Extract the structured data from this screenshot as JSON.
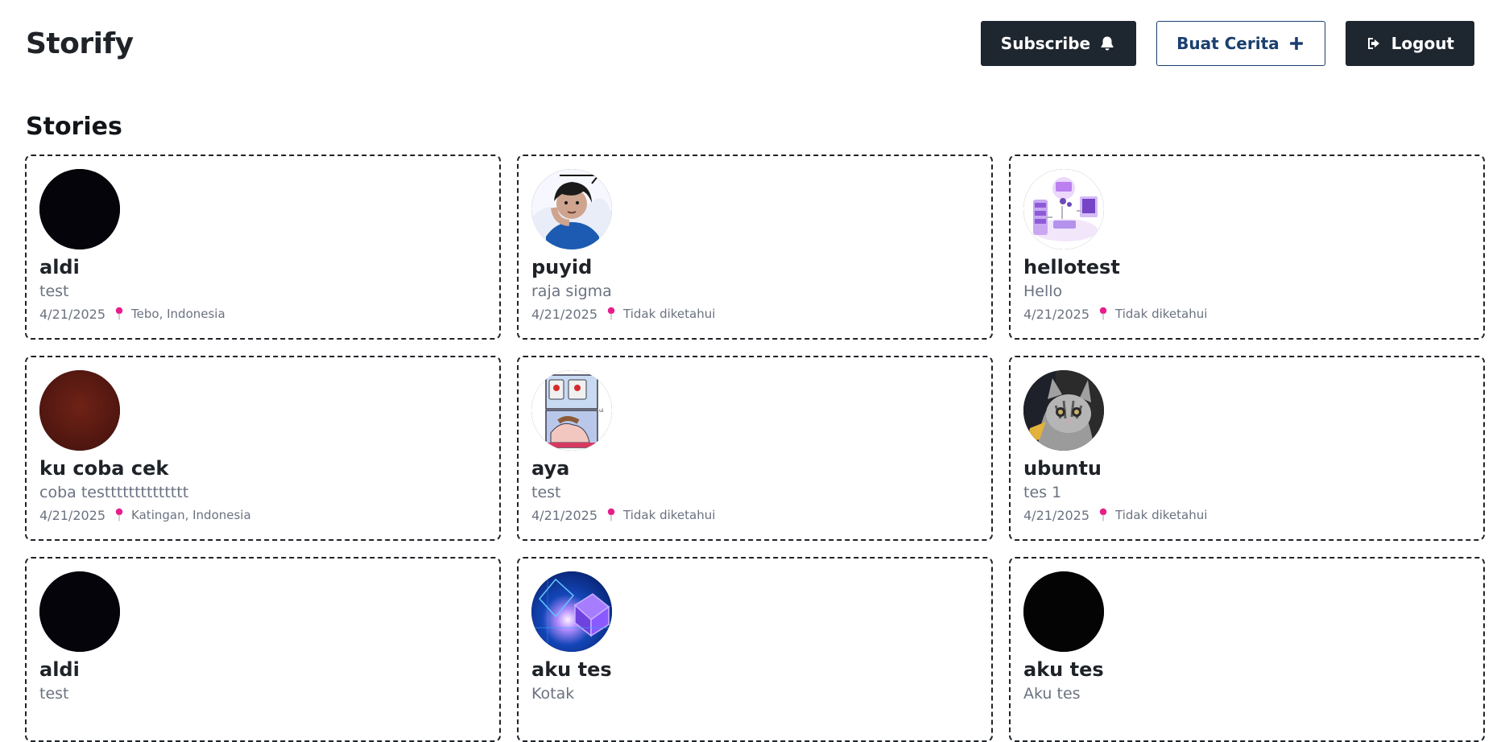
{
  "header": {
    "brand": "Storify",
    "subscribe_label": "Subscribe",
    "create_label": "Buat Cerita",
    "logout_label": "Logout"
  },
  "section": {
    "title": "Stories"
  },
  "stories": [
    {
      "name": "aldi",
      "description": "test",
      "date": "4/21/2025",
      "location": "Tebo, Indonesia",
      "avatar_icon": "dark-avatar"
    },
    {
      "name": "puyid",
      "description": "raja sigma",
      "date": "4/21/2025",
      "location": "Tidak diketahui",
      "avatar_icon": "person-photo-avatar"
    },
    {
      "name": "hellotest",
      "description": "Hello",
      "date": "4/21/2025",
      "location": "Tidak diketahui",
      "avatar_icon": "api-illustration-avatar"
    },
    {
      "name": "ku coba cek",
      "description": "coba testttttttttttttt",
      "date": "4/21/2025",
      "location": "Katingan, Indonesia",
      "avatar_icon": "red-brown-avatar"
    },
    {
      "name": "aya",
      "description": "test",
      "date": "4/21/2025",
      "location": "Tidak diketahui",
      "avatar_icon": "comic-meme-avatar"
    },
    {
      "name": "ubuntu",
      "description": "tes 1",
      "date": "4/21/2025",
      "location": "Tidak diketahui",
      "avatar_icon": "cat-photo-avatar"
    },
    {
      "name": "aldi",
      "description": "test",
      "date": "",
      "location": "",
      "avatar_icon": "dark-avatar"
    },
    {
      "name": "aku tes",
      "description": "Kotak",
      "date": "",
      "location": "",
      "avatar_icon": "blue-cube-avatar"
    },
    {
      "name": "aku tes",
      "description": "Aku tes",
      "date": "",
      "location": "",
      "avatar_icon": "black-avatar"
    }
  ],
  "colors": {
    "dark_button": "#1e2630",
    "outline_button": "#1b3f6f",
    "pin": "#e61e8c",
    "muted_text": "#6b7280"
  }
}
